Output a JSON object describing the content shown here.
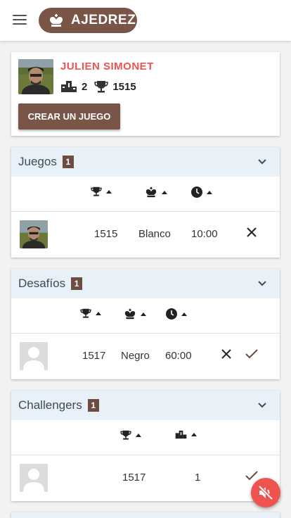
{
  "header": {
    "title": "AJEDREZ",
    "menu_icon": "hamburger-menu-icon",
    "brand_icon": "chess-king-icon",
    "brand_color": "#795548"
  },
  "profile": {
    "name": "JULIEN SIMONET",
    "name_color": "#ef5350",
    "tournaments": "2",
    "rating": "1515",
    "create_game_label": "CREAR UN JUEGO"
  },
  "juegos": {
    "title": "Juegos",
    "count": "1",
    "columns": [
      "trophy-icon",
      "chess-king-icon",
      "clock-icon"
    ],
    "rows": [
      {
        "rating": "1515",
        "color": "Blanco",
        "time": "10:00"
      }
    ]
  },
  "desafios": {
    "title": "Desafíos",
    "count": "1",
    "columns": [
      "trophy-icon",
      "chess-king-icon",
      "clock-icon"
    ],
    "rows": [
      {
        "rating": "1517",
        "color": "Negro",
        "time": "60:00"
      }
    ]
  },
  "challengers": {
    "title": "Challengers",
    "count": "1",
    "columns": [
      "trophy-icon",
      "podium-icon"
    ],
    "rows": [
      {
        "rating": "1517",
        "rank": "1"
      }
    ]
  },
  "fab": {
    "icon": "volume-mute-icon",
    "color": "#ef5350"
  }
}
